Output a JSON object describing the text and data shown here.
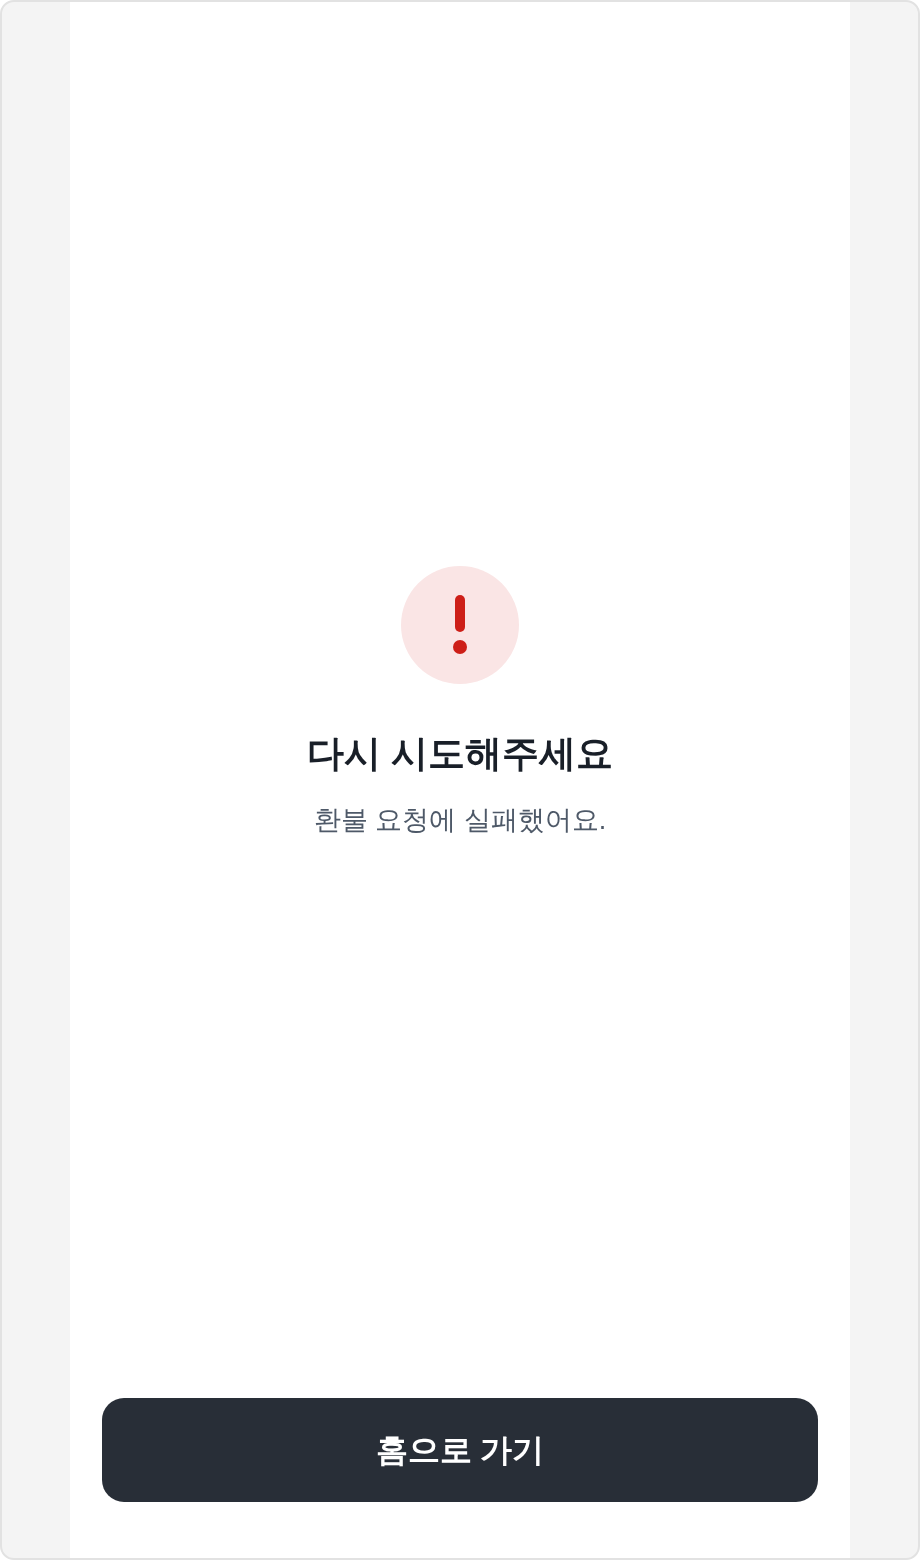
{
  "result": {
    "title": "다시 시도해주세요",
    "message": "환불 요청에 실패했어요."
  },
  "button": {
    "label": "홈으로 가기"
  }
}
